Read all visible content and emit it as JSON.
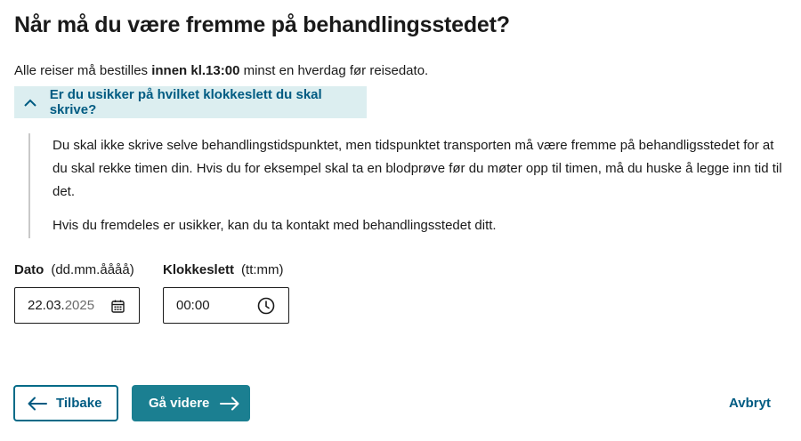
{
  "page": {
    "title": "Når må du være fremme på behandlingsstedet?",
    "intro": {
      "before": "Alle reiser må bestilles ",
      "bold": "innen kl.13:00",
      "after": " minst en hverdag før reisedato."
    }
  },
  "expander": {
    "label": "Er du usikker på hvilket klokkeslett du skal skrive?",
    "icon": "chevron-up-icon",
    "expanded": true,
    "paragraph1": "Du skal ikke skrive selve behandlingstidspunktet, men tidspunktet transporten må være fremme på behandligsstedet for at du skal rekke timen din. Hvis du for eksempel skal ta en blodprøve før du møter opp til timen, må du huske å legge inn tid til det.",
    "paragraph2": "Hvis du fremdeles er usikker, kan du ta kontakt med behandlingsstedet ditt."
  },
  "date_field": {
    "label": "Dato",
    "hint": "(dd.mm.åååå)",
    "value_dm": "22.03.",
    "value_year": "2025",
    "icon": "calendar-icon"
  },
  "time_field": {
    "label": "Klokkeslett",
    "hint": "(tt:mm)",
    "value": "00:00",
    "icon": "clock-icon"
  },
  "actions": {
    "back_label": "Tilbake",
    "next_label": "Gå videre",
    "cancel_label": "Avbryt"
  },
  "colors": {
    "accent": "#005b82",
    "primary_button": "#1b7f91",
    "expander_bg": "#dceef0"
  }
}
